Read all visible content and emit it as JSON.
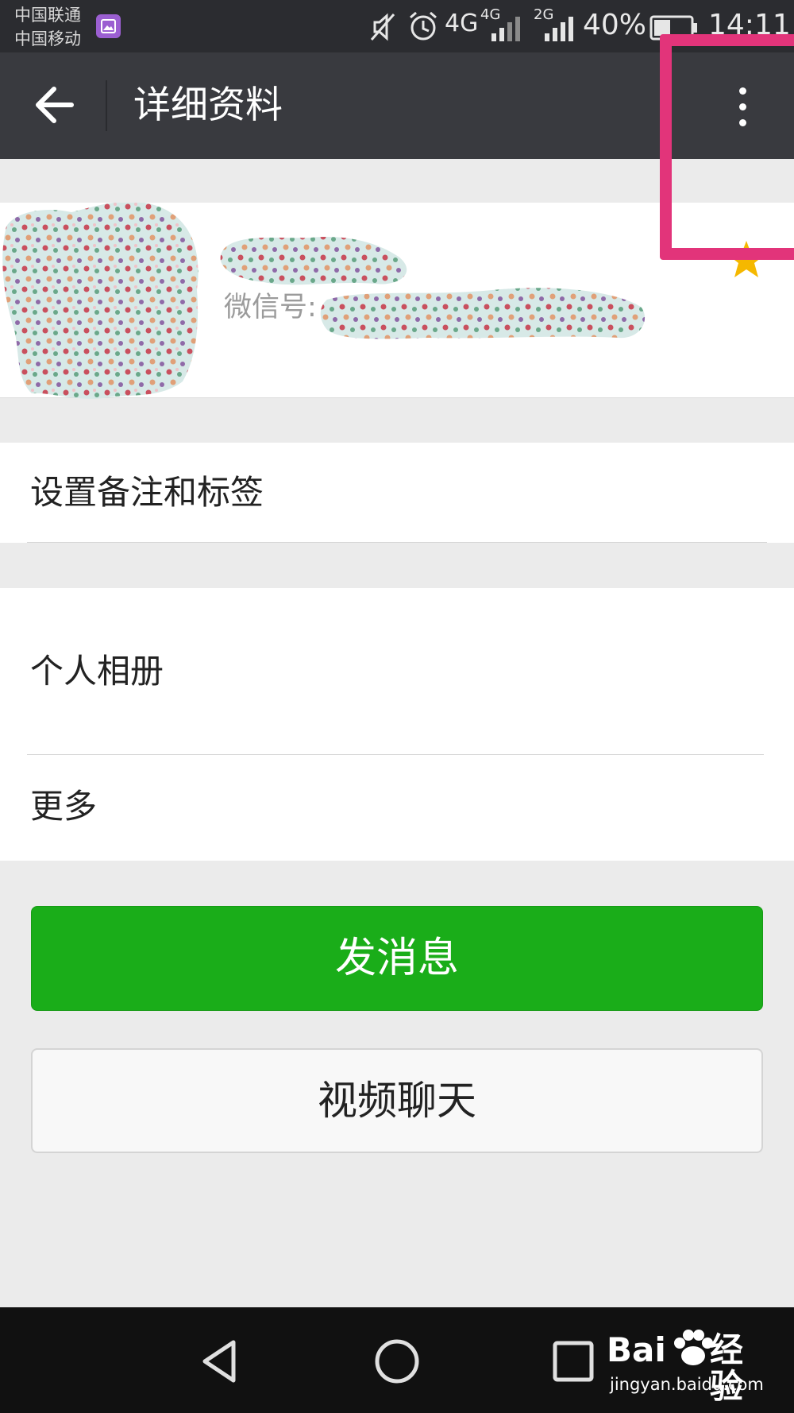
{
  "status_bar": {
    "carrier_1": "中国联通",
    "carrier_2": "中国移动",
    "network_1": "4G",
    "network_1_small": "4G",
    "network_2_small": "2G",
    "battery": "40%",
    "time": "14:11",
    "icons": [
      "gallery-icon",
      "mute-icon",
      "alarm-icon",
      "signal-icon",
      "battery-icon"
    ]
  },
  "app_bar": {
    "title": "详细资料",
    "back_icon": "arrow-left-icon",
    "menu_icon": "more-vertical-icon"
  },
  "profile": {
    "wxid_label": "微信号:",
    "starred": true,
    "star_color": "#f5b800"
  },
  "rows": {
    "remark_tags": "设置备注和标签",
    "album": "个人相册",
    "more": "更多"
  },
  "buttons": {
    "send_message": "发消息",
    "video_chat": "视频聊天"
  },
  "colors": {
    "primary_green": "#1aad19",
    "app_bar": "#393a3f",
    "highlight": "#e2347a"
  },
  "watermark": {
    "brand": "Bai",
    "brand_cn": "经验",
    "url": "jingyan.baidu.com"
  }
}
